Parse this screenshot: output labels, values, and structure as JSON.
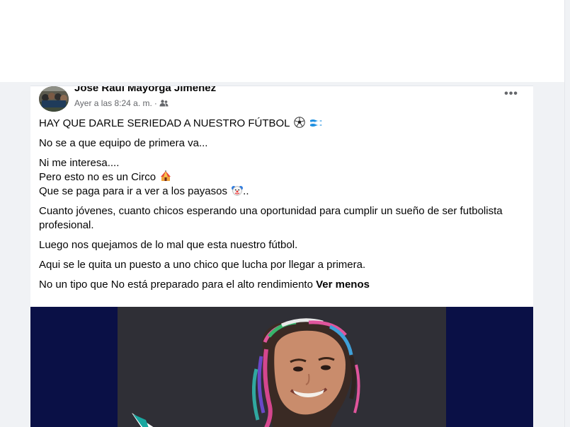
{
  "post": {
    "author": "José Raúl Mayorga Jiménez",
    "time": "Ayer a las 8:24 a. m.",
    "separator": "·",
    "audience_icon": "friends-icon",
    "more_label": "•••",
    "text": {
      "line1": "HAY QUE DARLE SERIEDAD A NUESTRO FÚTBOL",
      "line2": "No se a que equipo de primera va...",
      "line3a": "Ni me interesa....",
      "line3b": "Pero esto no es un Circo",
      "line3c": "Que se paga para ir a ver a los payasos",
      "line3c_tail": "..",
      "line4": "Cuanto jóvenes, cuanto chicos esperando una oportunidad para cumplir un sueño de ser futbolista profesional.",
      "line5": "Luego nos quejamos de lo mal que esta nuestro fútbol.",
      "line6": "Aqui se le quita un puesto a uno chico que lucha por llegar a primera.",
      "line7": "No un tipo que No está preparado para el alto rendimiento",
      "see_less": "Ver menos"
    },
    "emojis": [
      "soccer-ball-icon",
      "honduras-flag-icon",
      "circus-tent-icon",
      "clown-face-icon"
    ]
  },
  "colors": {
    "text": "#050505",
    "secondary_text": "#65676b",
    "feed_background": "#f0f2f5",
    "media_background": "#0a1046"
  }
}
